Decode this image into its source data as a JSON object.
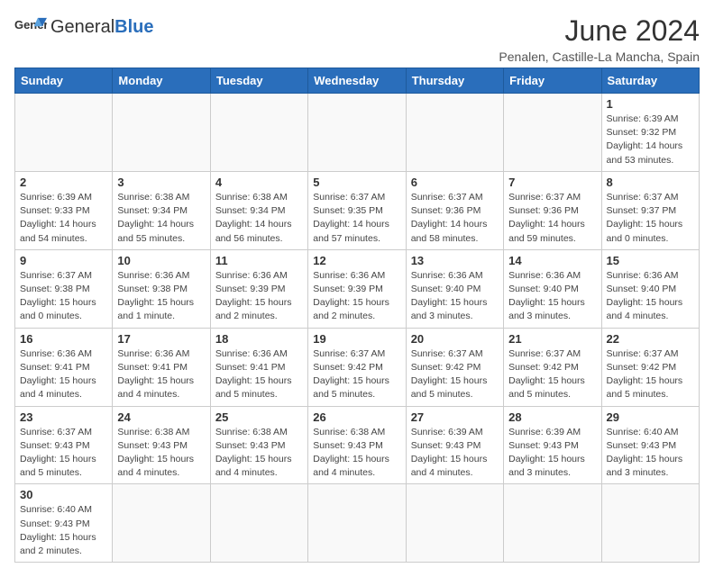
{
  "header": {
    "logo_general": "General",
    "logo_blue": "Blue",
    "title": "June 2024",
    "subtitle": "Penalen, Castille-La Mancha, Spain"
  },
  "weekdays": [
    "Sunday",
    "Monday",
    "Tuesday",
    "Wednesday",
    "Thursday",
    "Friday",
    "Saturday"
  ],
  "weeks": [
    [
      {
        "day": "",
        "info": ""
      },
      {
        "day": "",
        "info": ""
      },
      {
        "day": "",
        "info": ""
      },
      {
        "day": "",
        "info": ""
      },
      {
        "day": "",
        "info": ""
      },
      {
        "day": "",
        "info": ""
      },
      {
        "day": "1",
        "info": "Sunrise: 6:39 AM\nSunset: 9:32 PM\nDaylight: 14 hours and 53 minutes."
      }
    ],
    [
      {
        "day": "2",
        "info": "Sunrise: 6:39 AM\nSunset: 9:33 PM\nDaylight: 14 hours and 54 minutes."
      },
      {
        "day": "3",
        "info": "Sunrise: 6:38 AM\nSunset: 9:34 PM\nDaylight: 14 hours and 55 minutes."
      },
      {
        "day": "4",
        "info": "Sunrise: 6:38 AM\nSunset: 9:34 PM\nDaylight: 14 hours and 56 minutes."
      },
      {
        "day": "5",
        "info": "Sunrise: 6:37 AM\nSunset: 9:35 PM\nDaylight: 14 hours and 57 minutes."
      },
      {
        "day": "6",
        "info": "Sunrise: 6:37 AM\nSunset: 9:36 PM\nDaylight: 14 hours and 58 minutes."
      },
      {
        "day": "7",
        "info": "Sunrise: 6:37 AM\nSunset: 9:36 PM\nDaylight: 14 hours and 59 minutes."
      },
      {
        "day": "8",
        "info": "Sunrise: 6:37 AM\nSunset: 9:37 PM\nDaylight: 15 hours and 0 minutes."
      }
    ],
    [
      {
        "day": "9",
        "info": "Sunrise: 6:37 AM\nSunset: 9:38 PM\nDaylight: 15 hours and 0 minutes."
      },
      {
        "day": "10",
        "info": "Sunrise: 6:36 AM\nSunset: 9:38 PM\nDaylight: 15 hours and 1 minute."
      },
      {
        "day": "11",
        "info": "Sunrise: 6:36 AM\nSunset: 9:39 PM\nDaylight: 15 hours and 2 minutes."
      },
      {
        "day": "12",
        "info": "Sunrise: 6:36 AM\nSunset: 9:39 PM\nDaylight: 15 hours and 2 minutes."
      },
      {
        "day": "13",
        "info": "Sunrise: 6:36 AM\nSunset: 9:40 PM\nDaylight: 15 hours and 3 minutes."
      },
      {
        "day": "14",
        "info": "Sunrise: 6:36 AM\nSunset: 9:40 PM\nDaylight: 15 hours and 3 minutes."
      },
      {
        "day": "15",
        "info": "Sunrise: 6:36 AM\nSunset: 9:40 PM\nDaylight: 15 hours and 4 minutes."
      }
    ],
    [
      {
        "day": "16",
        "info": "Sunrise: 6:36 AM\nSunset: 9:41 PM\nDaylight: 15 hours and 4 minutes."
      },
      {
        "day": "17",
        "info": "Sunrise: 6:36 AM\nSunset: 9:41 PM\nDaylight: 15 hours and 4 minutes."
      },
      {
        "day": "18",
        "info": "Sunrise: 6:36 AM\nSunset: 9:41 PM\nDaylight: 15 hours and 5 minutes."
      },
      {
        "day": "19",
        "info": "Sunrise: 6:37 AM\nSunset: 9:42 PM\nDaylight: 15 hours and 5 minutes."
      },
      {
        "day": "20",
        "info": "Sunrise: 6:37 AM\nSunset: 9:42 PM\nDaylight: 15 hours and 5 minutes."
      },
      {
        "day": "21",
        "info": "Sunrise: 6:37 AM\nSunset: 9:42 PM\nDaylight: 15 hours and 5 minutes."
      },
      {
        "day": "22",
        "info": "Sunrise: 6:37 AM\nSunset: 9:42 PM\nDaylight: 15 hours and 5 minutes."
      }
    ],
    [
      {
        "day": "23",
        "info": "Sunrise: 6:37 AM\nSunset: 9:43 PM\nDaylight: 15 hours and 5 minutes."
      },
      {
        "day": "24",
        "info": "Sunrise: 6:38 AM\nSunset: 9:43 PM\nDaylight: 15 hours and 4 minutes."
      },
      {
        "day": "25",
        "info": "Sunrise: 6:38 AM\nSunset: 9:43 PM\nDaylight: 15 hours and 4 minutes."
      },
      {
        "day": "26",
        "info": "Sunrise: 6:38 AM\nSunset: 9:43 PM\nDaylight: 15 hours and 4 minutes."
      },
      {
        "day": "27",
        "info": "Sunrise: 6:39 AM\nSunset: 9:43 PM\nDaylight: 15 hours and 4 minutes."
      },
      {
        "day": "28",
        "info": "Sunrise: 6:39 AM\nSunset: 9:43 PM\nDaylight: 15 hours and 3 minutes."
      },
      {
        "day": "29",
        "info": "Sunrise: 6:40 AM\nSunset: 9:43 PM\nDaylight: 15 hours and 3 minutes."
      }
    ],
    [
      {
        "day": "30",
        "info": "Sunrise: 6:40 AM\nSunset: 9:43 PM\nDaylight: 15 hours and 2 minutes."
      },
      {
        "day": "",
        "info": ""
      },
      {
        "day": "",
        "info": ""
      },
      {
        "day": "",
        "info": ""
      },
      {
        "day": "",
        "info": ""
      },
      {
        "day": "",
        "info": ""
      },
      {
        "day": "",
        "info": ""
      }
    ]
  ]
}
